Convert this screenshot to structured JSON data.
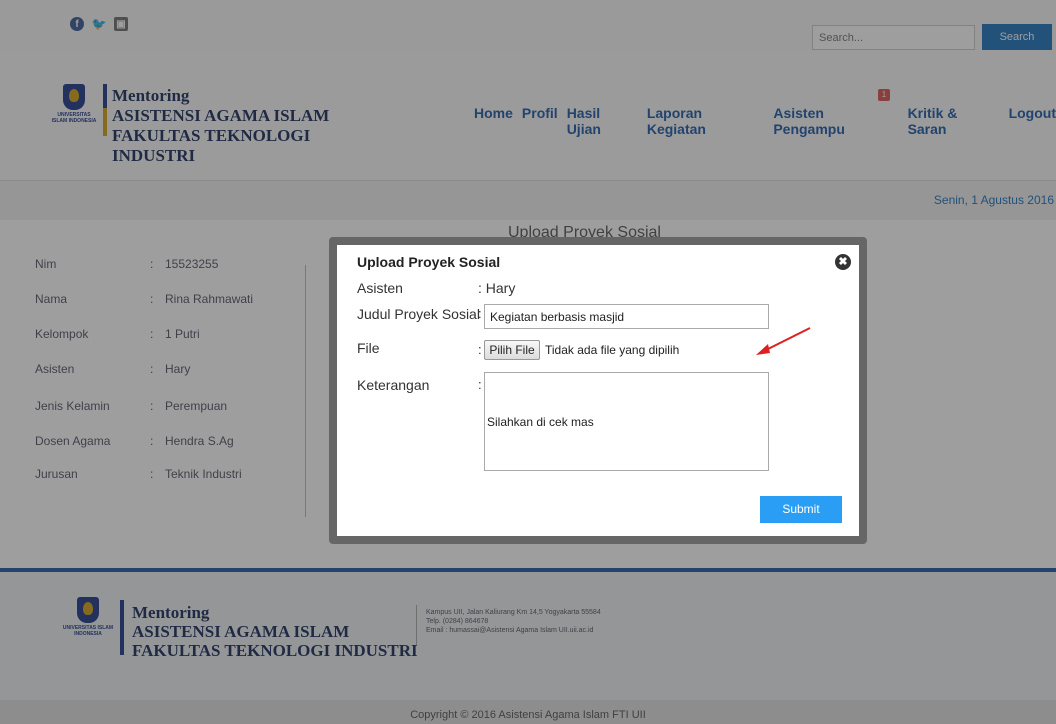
{
  "topbar": {
    "social_icons": [
      "facebook-icon",
      "twitter-icon",
      "instagram-icon"
    ],
    "search_placeholder": "Search...",
    "search_button": "Search"
  },
  "brand": {
    "logo_text": "UNIVERSITAS ISLAM INDONESIA",
    "line1": "Mentoring",
    "line2": "ASISTENSI AGAMA ISLAM",
    "line3": "FAKULTAS TEKNOLOGI",
    "line4": "INDUSTRI"
  },
  "nav": {
    "items": [
      "Home",
      "Profil",
      "Hasil Ujian",
      "Laporan Kegiatan",
      "Asisten Pengampu",
      "Kritik & Saran",
      "Logout"
    ],
    "badge": "1"
  },
  "date": "Senin, 1 Agustus 2016",
  "section_title": "Upload Proyek Sosial",
  "profile": {
    "rows": [
      {
        "key": "Nim",
        "value": "15523255"
      },
      {
        "key": "Nama",
        "value": "Rina Rahmawati"
      },
      {
        "key": "Kelompok",
        "value": "1 Putri"
      },
      {
        "key": "Asisten",
        "value": "Hary"
      },
      {
        "key": "Jenis Kelamin",
        "value": "Perempuan"
      },
      {
        "key": "Dosen Agama",
        "value": "Hendra S.Ag"
      },
      {
        "key": "Jurusan",
        "value": "Teknik Industri"
      }
    ]
  },
  "footer": {
    "brand1": "Mentoring",
    "brand2": "ASISTENSI AGAMA ISLAM",
    "brand3": "FAKULTAS TEKNOLOGI INDUSTRI",
    "address1": "Kampus UII, Jalan Kaliurang Km 14,5 Yogyakarta 55584",
    "address2": "Telp. (0284) 864678",
    "address3": "Email : humassai@Asistensi Agama Islam UII.uii.ac.id",
    "copyright": "Copyright © 2016 Asistensi Agama Islam FTI UII"
  },
  "modal": {
    "title": "Upload Proyek Sosial",
    "close_icon": "close-icon",
    "asisten_label": "Asisten",
    "asisten_value": ": Hary",
    "judul_label": "Judul Proyek Sosial",
    "judul_value": "Kegiatan berbasis masjid",
    "file_label": "File",
    "file_button": "Pilih File",
    "file_status": "Tidak ada file yang dipilih",
    "keterangan_label": "Keterangan",
    "keterangan_value": "Silahkan di cek mas",
    "submit": "Submit"
  },
  "colors": {
    "nav": "#1e5aa8",
    "search_button": "#1e73be",
    "submit_button": "#2a9df4",
    "arrow": "#e02020",
    "badge": "#d9534f"
  }
}
